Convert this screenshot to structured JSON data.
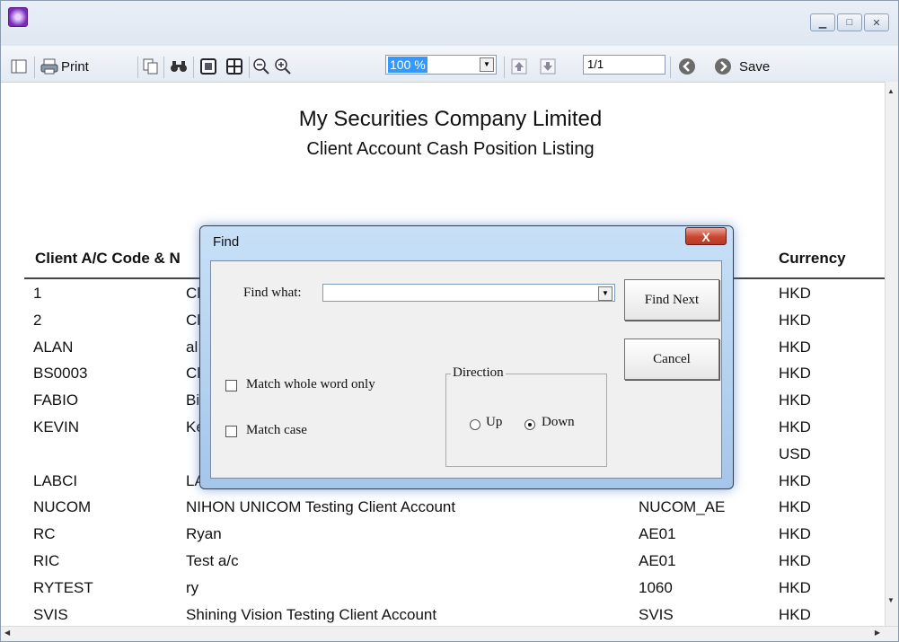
{
  "toolbar": {
    "print_label": "Print",
    "zoom_value": "100 %",
    "page_value": "1/1",
    "save_label": "Save"
  },
  "report": {
    "company": "My Securities Company Limited",
    "title": "Client Account Cash Position Listing",
    "col_client": "Client A/C Code & N",
    "col_currency": "Currency"
  },
  "rows": [
    {
      "code": "1",
      "name": "Cl",
      "ae": "",
      "ccy": "HKD"
    },
    {
      "code": "2",
      "name": "Cl",
      "ae": "",
      "ccy": "HKD"
    },
    {
      "code": "ALAN",
      "name": "al",
      "ae": "",
      "ccy": "HKD"
    },
    {
      "code": "BS0003",
      "name": "Cl",
      "ae": "",
      "ccy": "HKD"
    },
    {
      "code": "FABIO",
      "name": "Bi",
      "ae": "",
      "ccy": "HKD"
    },
    {
      "code": "KEVIN",
      "name": "Ke",
      "ae": "",
      "ccy": "HKD"
    },
    {
      "code": "",
      "name": "",
      "ae": "",
      "ccy": "USD"
    },
    {
      "code": "LABCI",
      "name": "LA",
      "ae": "",
      "ccy": "HKD"
    },
    {
      "code": "NUCOM",
      "name": "NIHON UNICOM Testing Client Account",
      "ae": "NUCOM_AE",
      "ccy": "HKD"
    },
    {
      "code": "RC",
      "name": "Ryan",
      "ae": "AE01",
      "ccy": "HKD"
    },
    {
      "code": "RIC",
      "name": "Test a/c",
      "ae": "AE01",
      "ccy": "HKD"
    },
    {
      "code": "RYTEST",
      "name": "ry",
      "ae": "1060",
      "ccy": "HKD"
    },
    {
      "code": "SVIS",
      "name": "Shining Vision Testing Client Account",
      "ae": "SVIS",
      "ccy": "HKD"
    }
  ],
  "find_dialog": {
    "title": "Find",
    "close_label": "X",
    "find_what_label": "Find what:",
    "find_what_value": "",
    "find_next_label": "Find Next",
    "cancel_label": "Cancel",
    "match_whole_word_label": "Match whole word only",
    "match_whole_word_checked": false,
    "match_case_label": "Match case",
    "match_case_checked": false,
    "direction_label": "Direction",
    "up_label": "Up",
    "down_label": "Down",
    "direction_selected": "Down"
  }
}
